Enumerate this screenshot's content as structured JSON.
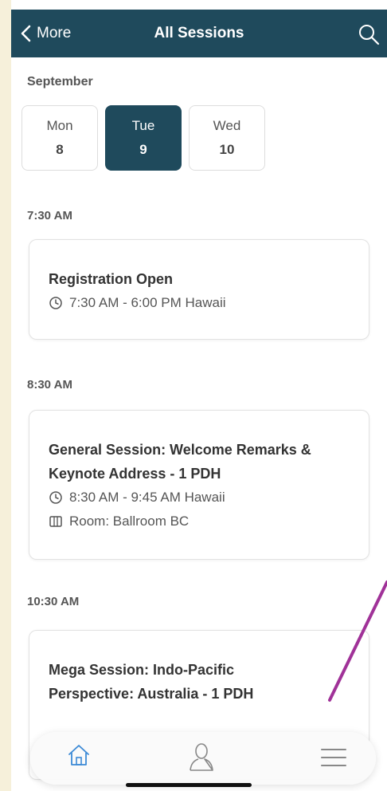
{
  "header": {
    "back_label": "More",
    "title": "All Sessions"
  },
  "month": "September",
  "days": [
    {
      "name": "Mon",
      "date": "8"
    },
    {
      "name": "Tue",
      "date": "9"
    },
    {
      "name": "Wed",
      "date": "10"
    }
  ],
  "selected_day": "Tue",
  "sessions": [
    {
      "time_label": "7:30 AM",
      "title_lines": [
        "Registration Open"
      ],
      "time": "7:30 AM - 6:00 PM Hawaii"
    },
    {
      "time_label": "8:30 AM",
      "title_lines": [
        "General Session: Welcome Remarks &",
        "Keynote Address - 1 PDH"
      ],
      "time": "8:30 AM - 9:45 AM Hawaii",
      "room": "Room: Ballroom BC"
    },
    {
      "time_label": "10:30 AM",
      "title_lines": [
        "Mega Session: Indo-Pacific",
        "Perspective: Australia - 1 PDH"
      ]
    }
  ],
  "colors": {
    "header_bg": "#1f4a5c",
    "accent": "#3c8ad6",
    "annotation": "#a03298"
  },
  "tabs": [
    "home-icon",
    "profile-icon",
    "menu-icon"
  ]
}
